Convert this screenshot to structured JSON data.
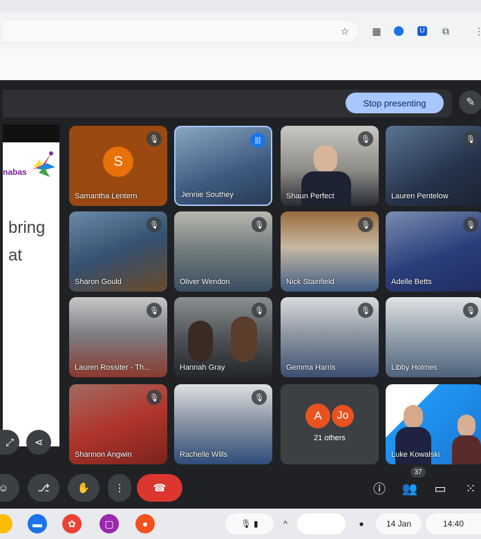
{
  "browser": {
    "toolbar_icons": [
      "star-icon",
      "qr-icon",
      "vpn-icon",
      "bitwarden-icon",
      "extensions-icon",
      "menu-icon"
    ]
  },
  "meet": {
    "stop_presenting": "Stop presenting",
    "slide": {
      "logo_text": "nabas",
      "line1": "bring",
      "line2": "at"
    },
    "participants": [
      {
        "name": "Samantha Lentern",
        "initial": "S",
        "kind": "avatar"
      },
      {
        "name": "Jennie Southey",
        "kind": "video",
        "speaking": true
      },
      {
        "name": "Shaun Perfect",
        "kind": "video"
      },
      {
        "name": "Lauren Pentelow",
        "kind": "video"
      },
      {
        "name": "Sharon Gould",
        "kind": "video"
      },
      {
        "name": "Oliver Wendon",
        "kind": "video"
      },
      {
        "name": "Nick Stainfield",
        "kind": "video"
      },
      {
        "name": "Adelle Betts",
        "kind": "video"
      },
      {
        "name": "Lauren Rossiter - Th...",
        "kind": "video"
      },
      {
        "name": "Hannah Gray",
        "kind": "video"
      },
      {
        "name": "Gemma Harris",
        "kind": "video"
      },
      {
        "name": "Libby Holmes",
        "kind": "video"
      },
      {
        "name": "Shannon Angwin",
        "kind": "video"
      },
      {
        "name": "Rachelle Wills",
        "kind": "video"
      },
      {
        "name": "Luke Kowalski",
        "kind": "video"
      }
    ],
    "others": {
      "initial1": "A",
      "initial2": "Jo",
      "label": "21 others"
    },
    "people_count": "37"
  },
  "taskbar": {
    "date": "14 Jan",
    "time": "14:40"
  },
  "colors": {
    "accent": "#a8c7fa",
    "end_call": "#dc362e",
    "background": "#202124",
    "avatar_orange": "#e8710a"
  }
}
